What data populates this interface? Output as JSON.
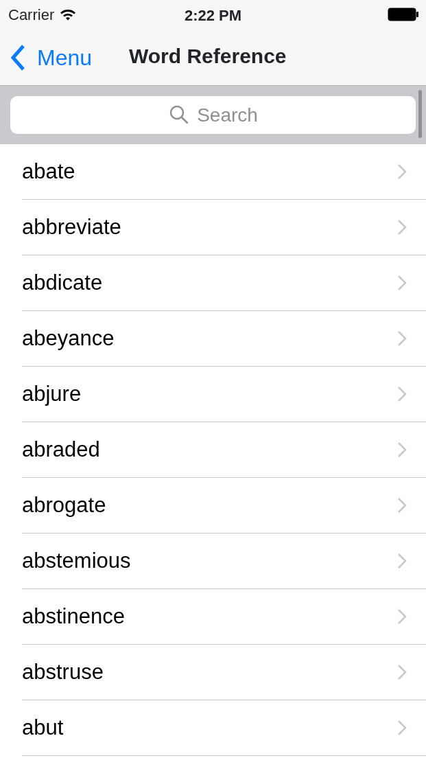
{
  "status_bar": {
    "carrier": "Carrier",
    "time": "2:22 PM"
  },
  "nav_bar": {
    "back": "Menu",
    "title": "Word Reference"
  },
  "search": {
    "placeholder": "Search"
  },
  "words": [
    {
      "label": "abate"
    },
    {
      "label": "abbreviate"
    },
    {
      "label": "abdicate"
    },
    {
      "label": "abeyance"
    },
    {
      "label": "abjure"
    },
    {
      "label": "abraded"
    },
    {
      "label": "abrogate"
    },
    {
      "label": "abstemious"
    },
    {
      "label": "abstinence"
    },
    {
      "label": "abstruse"
    },
    {
      "label": "abut"
    }
  ]
}
